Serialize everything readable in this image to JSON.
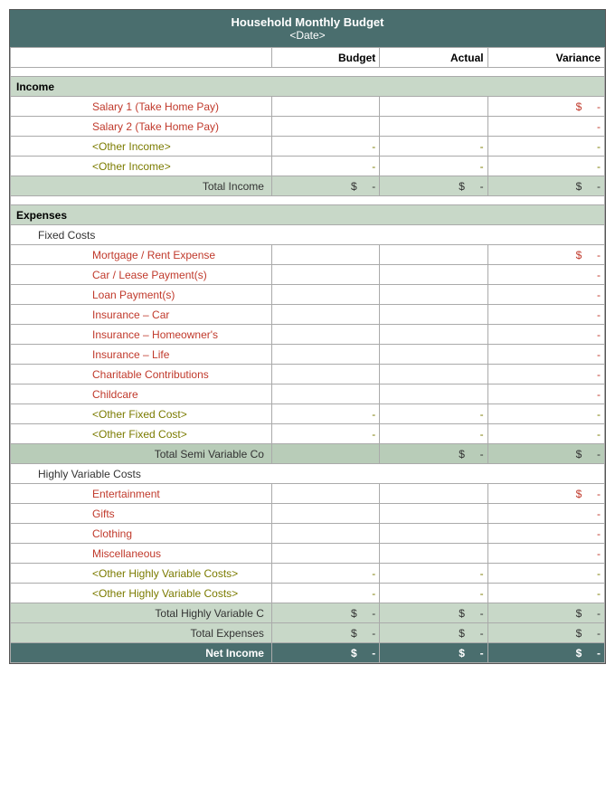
{
  "title": "Household Monthly Budget",
  "subtitle": "<Date>",
  "headers": {
    "label": "",
    "budget": "Budget",
    "actual": "Actual",
    "variance": "Variance"
  },
  "sections": {
    "income": {
      "label": "Income",
      "items": [
        {
          "label": "Salary 1 (Take Home Pay)",
          "budget": "",
          "actual": "",
          "variance_dollar": "$",
          "variance": "-"
        },
        {
          "label": "Salary 2 (Take Home Pay)",
          "budget": "",
          "actual": "",
          "variance": "-"
        },
        {
          "label": "<Other Income>",
          "budget": "-",
          "actual": "-",
          "variance": "-"
        },
        {
          "label": "<Other Income>",
          "budget": "-",
          "actual": "-",
          "variance": "-"
        }
      ],
      "total": {
        "label": "Total Income",
        "budget_dollar": "$",
        "budget": "-",
        "actual_dollar": "$",
        "actual": "-",
        "variance_dollar": "$",
        "variance": "-"
      }
    },
    "expenses": {
      "label": "Expenses",
      "fixed": {
        "label": "Fixed Costs",
        "items": [
          {
            "label": "Mortgage / Rent Expense",
            "budget": "",
            "actual": "",
            "variance_dollar": "$",
            "variance": "-"
          },
          {
            "label": "Car / Lease Payment(s)",
            "budget": "",
            "actual": "",
            "variance": "-"
          },
          {
            "label": "Loan Payment(s)",
            "budget": "",
            "actual": "",
            "variance": "-"
          },
          {
            "label": "Insurance – Car",
            "budget": "",
            "actual": "",
            "variance": "-"
          },
          {
            "label": "Insurance – Homeowner's",
            "budget": "",
            "actual": "",
            "variance": "-"
          },
          {
            "label": "Insurance – Life",
            "budget": "",
            "actual": "",
            "variance": "-"
          },
          {
            "label": "Charitable Contributions",
            "budget": "",
            "actual": "",
            "variance": "-"
          },
          {
            "label": "Childcare",
            "budget": "",
            "actual": "",
            "variance": "-"
          }
        ],
        "other": [
          {
            "label": "<Other Fixed Cost>",
            "budget": "-",
            "actual": "-",
            "variance": "-"
          },
          {
            "label": "<Other Fixed Cost>",
            "budget": "-",
            "actual": "-",
            "variance": "-"
          }
        ],
        "total": {
          "label": "Total Semi Variable Co",
          "actual_dollar": "$",
          "actual": "-",
          "variance_dollar": "$",
          "variance": "-"
        }
      },
      "variable": {
        "label": "Highly Variable Costs",
        "items": [
          {
            "label": "Entertainment",
            "budget": "",
            "actual": "",
            "variance_dollar": "$",
            "variance": "-"
          },
          {
            "label": "Gifts",
            "budget": "",
            "actual": "",
            "variance": "-"
          },
          {
            "label": "Clothing",
            "budget": "",
            "actual": "",
            "variance": "-"
          },
          {
            "label": "Miscellaneous",
            "budget": "",
            "actual": "",
            "variance": "-"
          }
        ],
        "other": [
          {
            "label": "<Other Highly Variable Costs>",
            "budget": "-",
            "actual": "-",
            "variance": "-"
          },
          {
            "label": "<Other Highly Variable Costs>",
            "budget": "-",
            "actual": "-",
            "variance": "-"
          }
        ],
        "total": {
          "label": "Total Highly Variable C",
          "budget_dollar": "$",
          "budget": "-",
          "actual_dollar": "$",
          "actual": "-",
          "variance_dollar": "$",
          "variance": "-"
        }
      },
      "total_expenses": {
        "label": "Total Expenses",
        "budget_dollar": "$",
        "budget": "-",
        "actual_dollar": "$",
        "actual": "-",
        "variance_dollar": "$",
        "variance": "-"
      }
    },
    "net_income": {
      "label": "Net Income",
      "budget_dollar": "$",
      "budget": "-",
      "actual_dollar": "$",
      "actual": "-",
      "variance_dollar": "$",
      "variance": "-"
    }
  }
}
